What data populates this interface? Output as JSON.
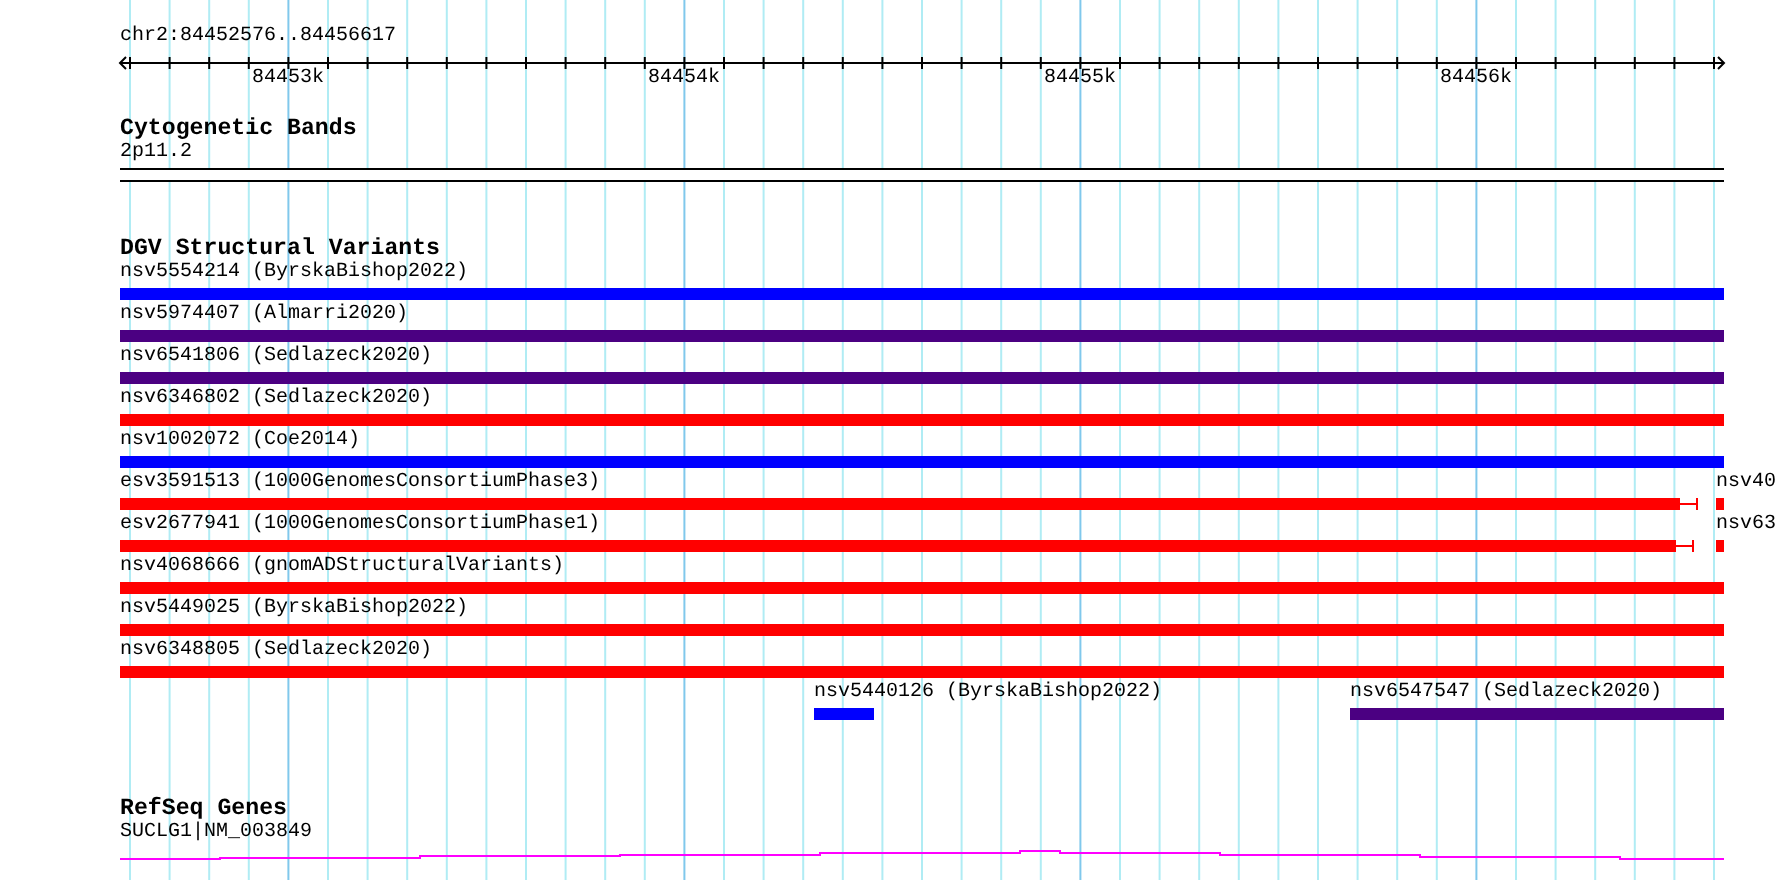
{
  "ruler": {
    "region": "chr2:84452576..84456617",
    "ticks": [
      "84453k",
      "84454k",
      "84455k",
      "84456k"
    ]
  },
  "cytogenetic_bands": {
    "title": "Cytogenetic Bands",
    "band": "2p11.2"
  },
  "dgv_structural_variants": {
    "title": "DGV Structural Variants",
    "rows": [
      {
        "features": [
          {
            "label": "nsv5554214 (ByrskaBishop2022)",
            "color": "#0000ff",
            "kind": "bar"
          }
        ]
      },
      {
        "features": [
          {
            "label": "nsv5974407 (Almarri2020)",
            "color": "#4b0082",
            "kind": "bar"
          }
        ]
      },
      {
        "features": [
          {
            "label": "nsv6541806 (Sedlazeck2020)",
            "color": "#4b0082",
            "kind": "bar"
          }
        ]
      },
      {
        "features": [
          {
            "label": "nsv6346802 (Sedlazeck2020)",
            "color": "#ff0000",
            "kind": "bar"
          }
        ]
      },
      {
        "features": [
          {
            "label": "nsv1002072 (Coe2014)",
            "color": "#0000ff",
            "kind": "bar"
          }
        ]
      },
      {
        "features": [
          {
            "label": "esv3591513 (1000GenomesConsortiumPhase3)",
            "color": "#ff0000",
            "kind": "capped"
          },
          {
            "label": "nsv40",
            "color": "#ff0000",
            "kind": "bar"
          }
        ]
      },
      {
        "features": [
          {
            "label": "esv2677941 (1000GenomesConsortiumPhase1)",
            "color": "#ff0000",
            "kind": "capped"
          },
          {
            "label": "nsv63",
            "color": "#ff0000",
            "kind": "bar"
          }
        ]
      },
      {
        "features": [
          {
            "label": "nsv4068666 (gnomADStructuralVariants)",
            "color": "#ff0000",
            "kind": "bar"
          }
        ]
      },
      {
        "features": [
          {
            "label": "nsv5449025 (ByrskaBishop2022)",
            "color": "#ff0000",
            "kind": "bar"
          }
        ]
      },
      {
        "features": [
          {
            "label": "nsv6348805 (Sedlazeck2020)",
            "color": "#ff0000",
            "kind": "bar"
          }
        ]
      },
      {
        "features": [
          {
            "label": "nsv5440126 (ByrskaBishop2022)",
            "color": "#0000ff",
            "kind": "bar"
          },
          {
            "label": "nsv6547547 (Sedlazeck2020)",
            "color": "#4b0082",
            "kind": "bar"
          }
        ]
      }
    ]
  },
  "refseq_genes": {
    "title": "RefSeq Genes",
    "gene": "SUCLG1|NM_003849"
  }
}
